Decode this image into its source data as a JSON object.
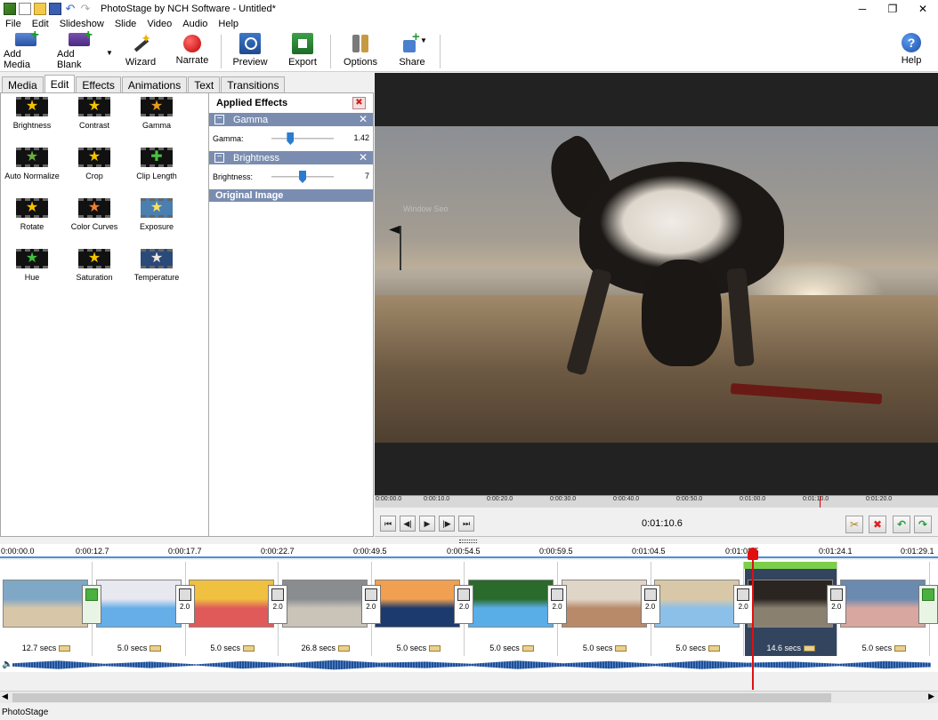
{
  "window": {
    "title": "PhotoStage by NCH Software - Untitled*",
    "minimize": "─",
    "maximize": "❐",
    "close": "✕"
  },
  "menu": [
    "File",
    "Edit",
    "Slideshow",
    "Slide",
    "Video",
    "Audio",
    "Help"
  ],
  "toolbar": {
    "add_media": "Add Media",
    "add_blank": "Add Blank",
    "wizard": "Wizard",
    "narrate": "Narrate",
    "preview": "Preview",
    "export": "Export",
    "options": "Options",
    "share": "Share",
    "help": "Help"
  },
  "tabs": [
    "Media",
    "Edit",
    "Effects",
    "Animations",
    "Text",
    "Transitions"
  ],
  "active_tab": "Edit",
  "effects": [
    "Brightness",
    "Contrast",
    "Gamma",
    "Auto Normalize",
    "Crop",
    "Clip Length",
    "Rotate",
    "Color Curves",
    "Exposure",
    "Hue",
    "Saturation",
    "Temperature"
  ],
  "applied": {
    "title": "Applied Effects",
    "gamma": {
      "name": "Gamma",
      "label": "Gamma:",
      "value": "1.42",
      "level": 0.28
    },
    "brightness": {
      "name": "Brightness",
      "label": "Brightness:",
      "value": "7",
      "level": 0.5
    },
    "original": "Original Image"
  },
  "preview": {
    "watermark": "Window Seo",
    "ruler": [
      "0:00:00.0",
      "0:00:10.0",
      "0:00:20.0",
      "0:00:30.0",
      "0:00:40.0",
      "0:00:50.0",
      "0:01:00.0",
      "0:01:10.0",
      "0:01:20.0"
    ],
    "time": "0:01:10.6"
  },
  "timeline": {
    "ruler": [
      "0:00:00.0",
      "0:00:12.7",
      "0:00:17.7",
      "0:00:22.7",
      "0:00:49.5",
      "0:00:54.5",
      "0:00:59.5",
      "0:01:04.5",
      "0:01:0?.5",
      "0:01:24.1",
      "0:01:29.1"
    ],
    "clips": [
      {
        "dur": "12.7 secs",
        "colors": [
          "#d8c6a8",
          "#7fa7c6"
        ]
      },
      {
        "dur": "5.0 secs",
        "colors": [
          "#66aee8",
          "#e8e8f0"
        ]
      },
      {
        "dur": "5.0 secs",
        "colors": [
          "#e05a5a",
          "#f0c040"
        ]
      },
      {
        "dur": "26.8 secs",
        "colors": [
          "#c9c3b8",
          "#8a8d90"
        ]
      },
      {
        "dur": "5.0 secs",
        "colors": [
          "#1d3a6e",
          "#f0a050"
        ]
      },
      {
        "dur": "5.0 secs",
        "colors": [
          "#5aaee8",
          "#2a6a2a"
        ]
      },
      {
        "dur": "5.0 secs",
        "colors": [
          "#b88a6a",
          "#e0d6c8"
        ]
      },
      {
        "dur": "5.0 secs",
        "colors": [
          "#8cc0e8",
          "#d8c8a8"
        ]
      },
      {
        "dur": "14.6 secs",
        "colors": [
          "#8a8070",
          "#2a2520"
        ]
      },
      {
        "dur": "5.0 secs",
        "colors": [
          "#d8a8a0",
          "#6a8ab0"
        ]
      }
    ],
    "transition_value": "2.0"
  },
  "status": "PhotoStage"
}
